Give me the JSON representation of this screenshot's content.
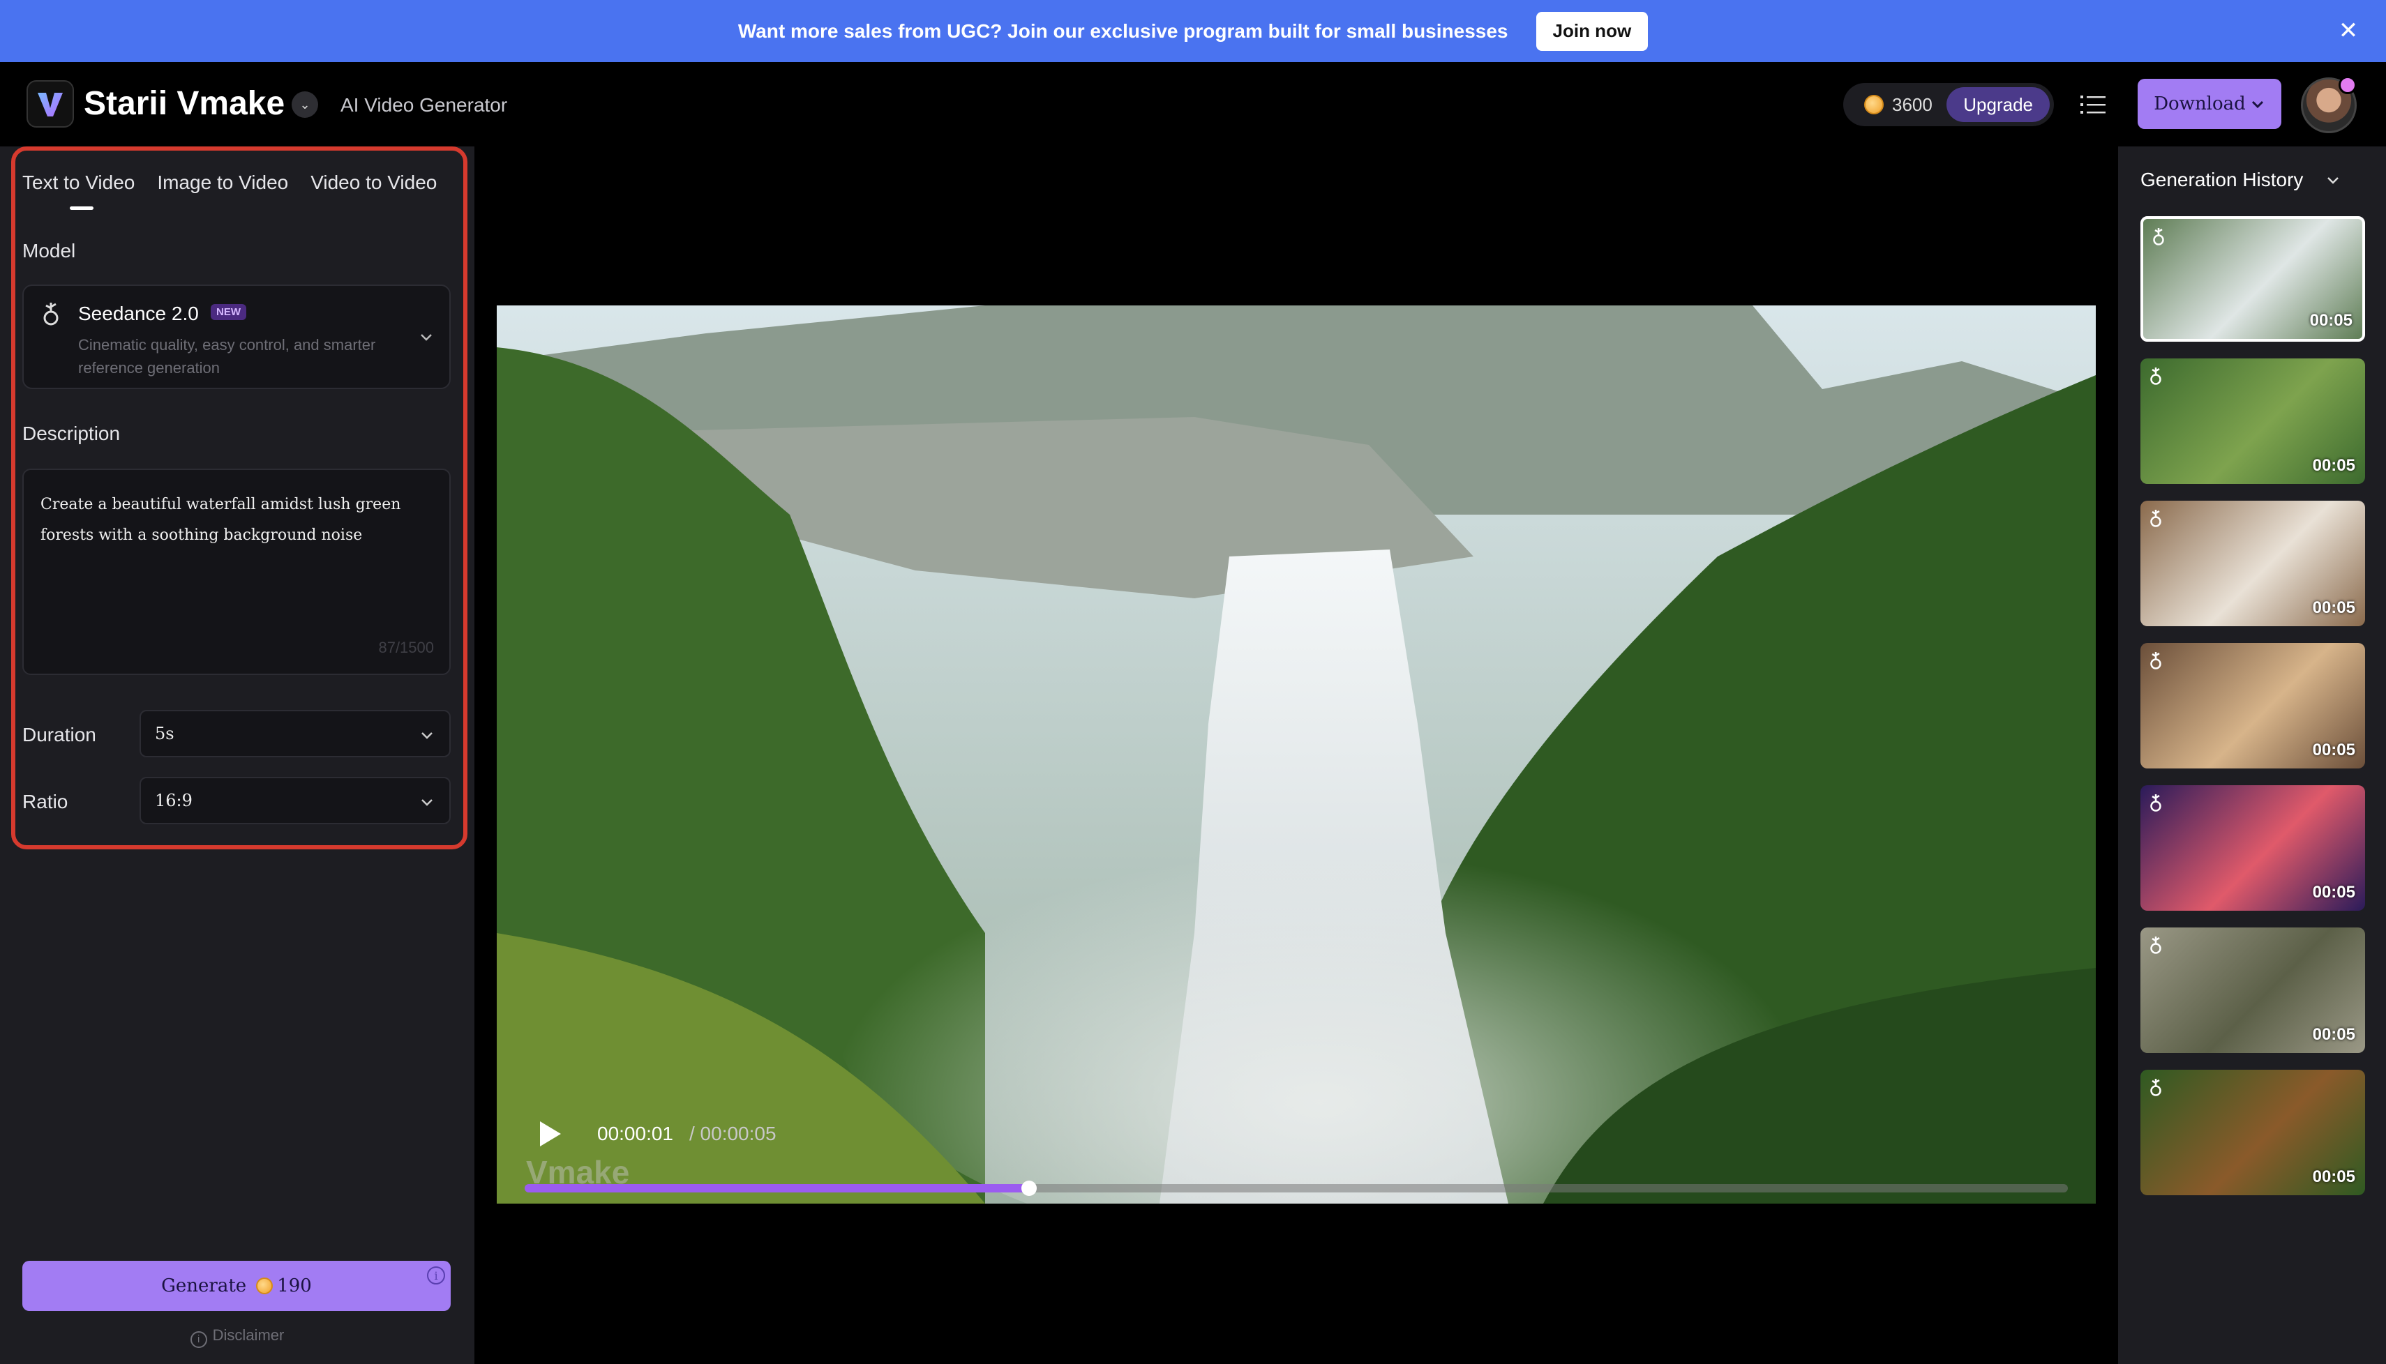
{
  "banner": {
    "text": "Want more sales from UGC? Join our exclusive program built for small businesses",
    "cta_label": "Join now",
    "close_icon": "close-icon"
  },
  "header": {
    "app_name": "Starii Vmake",
    "subtitle": "AI Video Generator",
    "credits": "3600",
    "upgrade_label": "Upgrade",
    "download_label": "Download"
  },
  "tabs": [
    {
      "label": "Text to Video",
      "active": true
    },
    {
      "label": "Image to Video",
      "active": false
    },
    {
      "label": "Video to Video",
      "active": false
    }
  ],
  "model": {
    "section_label": "Model",
    "name": "Seedance 2.0",
    "badge": "NEW",
    "description": "Cinematic quality, easy control, and smarter reference generation"
  },
  "description": {
    "section_label": "Description",
    "text": "Create a beautiful waterfall amidst lush green forests with a soothing background noise",
    "count": "87/1500"
  },
  "duration": {
    "label": "Duration",
    "value": "5s"
  },
  "ratio": {
    "label": "Ratio",
    "value": "16:9"
  },
  "generate": {
    "label": "Generate",
    "cost": "190",
    "info_icon": "info-icon"
  },
  "disclaimer": {
    "label": "Disclaimer"
  },
  "player": {
    "current_time": "00:00:01",
    "total_time": "/ 00:00:05",
    "watermark": "Vmake",
    "progress": 0.327
  },
  "history": {
    "title": "Generation History",
    "items": [
      {
        "duration": "00:05",
        "subject": "waterfall",
        "selected": true
      },
      {
        "duration": "00:05",
        "subject": "forest walk",
        "selected": false
      },
      {
        "duration": "00:05",
        "subject": "pouring tea",
        "selected": false
      },
      {
        "duration": "00:05",
        "subject": "woman with coffee",
        "selected": false
      },
      {
        "duration": "00:05",
        "subject": "cartoon character",
        "selected": false
      },
      {
        "duration": "00:05",
        "subject": "grass field",
        "selected": false
      },
      {
        "duration": "00:05",
        "subject": "cat in garden",
        "selected": false
      }
    ]
  },
  "colors": {
    "banner": "#4a73f0",
    "accent": "#a27cf3",
    "panel": "#1d1d22",
    "highlight": "#d63a2e",
    "progress": "#9b5cf0"
  }
}
